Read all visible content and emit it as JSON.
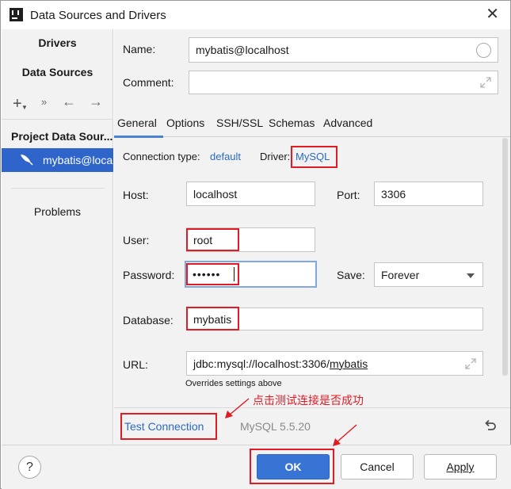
{
  "window": {
    "title": "Data Sources and Drivers"
  },
  "left": {
    "tabs": [
      "Drivers",
      "Data Sources"
    ],
    "group": "Project Data Sour...",
    "selected_item": "mybatis@local",
    "problems": "Problems"
  },
  "form": {
    "name_label": "Name:",
    "name_value": "mybatis@localhost",
    "comment_label": "Comment:",
    "comment_value": "",
    "tabs": [
      "General",
      "Options",
      "SSH/SSL",
      "Schemas",
      "Advanced"
    ],
    "conn_type_label": "Connection type:",
    "conn_type_value": "default",
    "driver_label": "Driver:",
    "driver_value": "MySQL",
    "host_label": "Host:",
    "host_value": "localhost",
    "port_label": "Port:",
    "port_value": "3306",
    "user_label": "User:",
    "user_value": "root",
    "password_label": "Password:",
    "password_value": "••••••",
    "save_label": "Save:",
    "save_value": "Forever",
    "database_label": "Database:",
    "database_value": "mybatis",
    "url_label": "URL:",
    "url_prefix": "jdbc:mysql://localhost:3306/",
    "url_db": "mybatis",
    "url_hint": "Overrides settings above"
  },
  "bottom": {
    "test_connection": "Test Connection",
    "version": "MySQL 5.5.20",
    "annotation": "点击测试连接是否成功"
  },
  "footer": {
    "help": "?",
    "ok": "OK",
    "cancel": "Cancel",
    "apply": "Apply"
  },
  "colors": {
    "accent": "#2f65ca",
    "link": "#2a6ac4",
    "annotation_red": "#e01b24"
  }
}
